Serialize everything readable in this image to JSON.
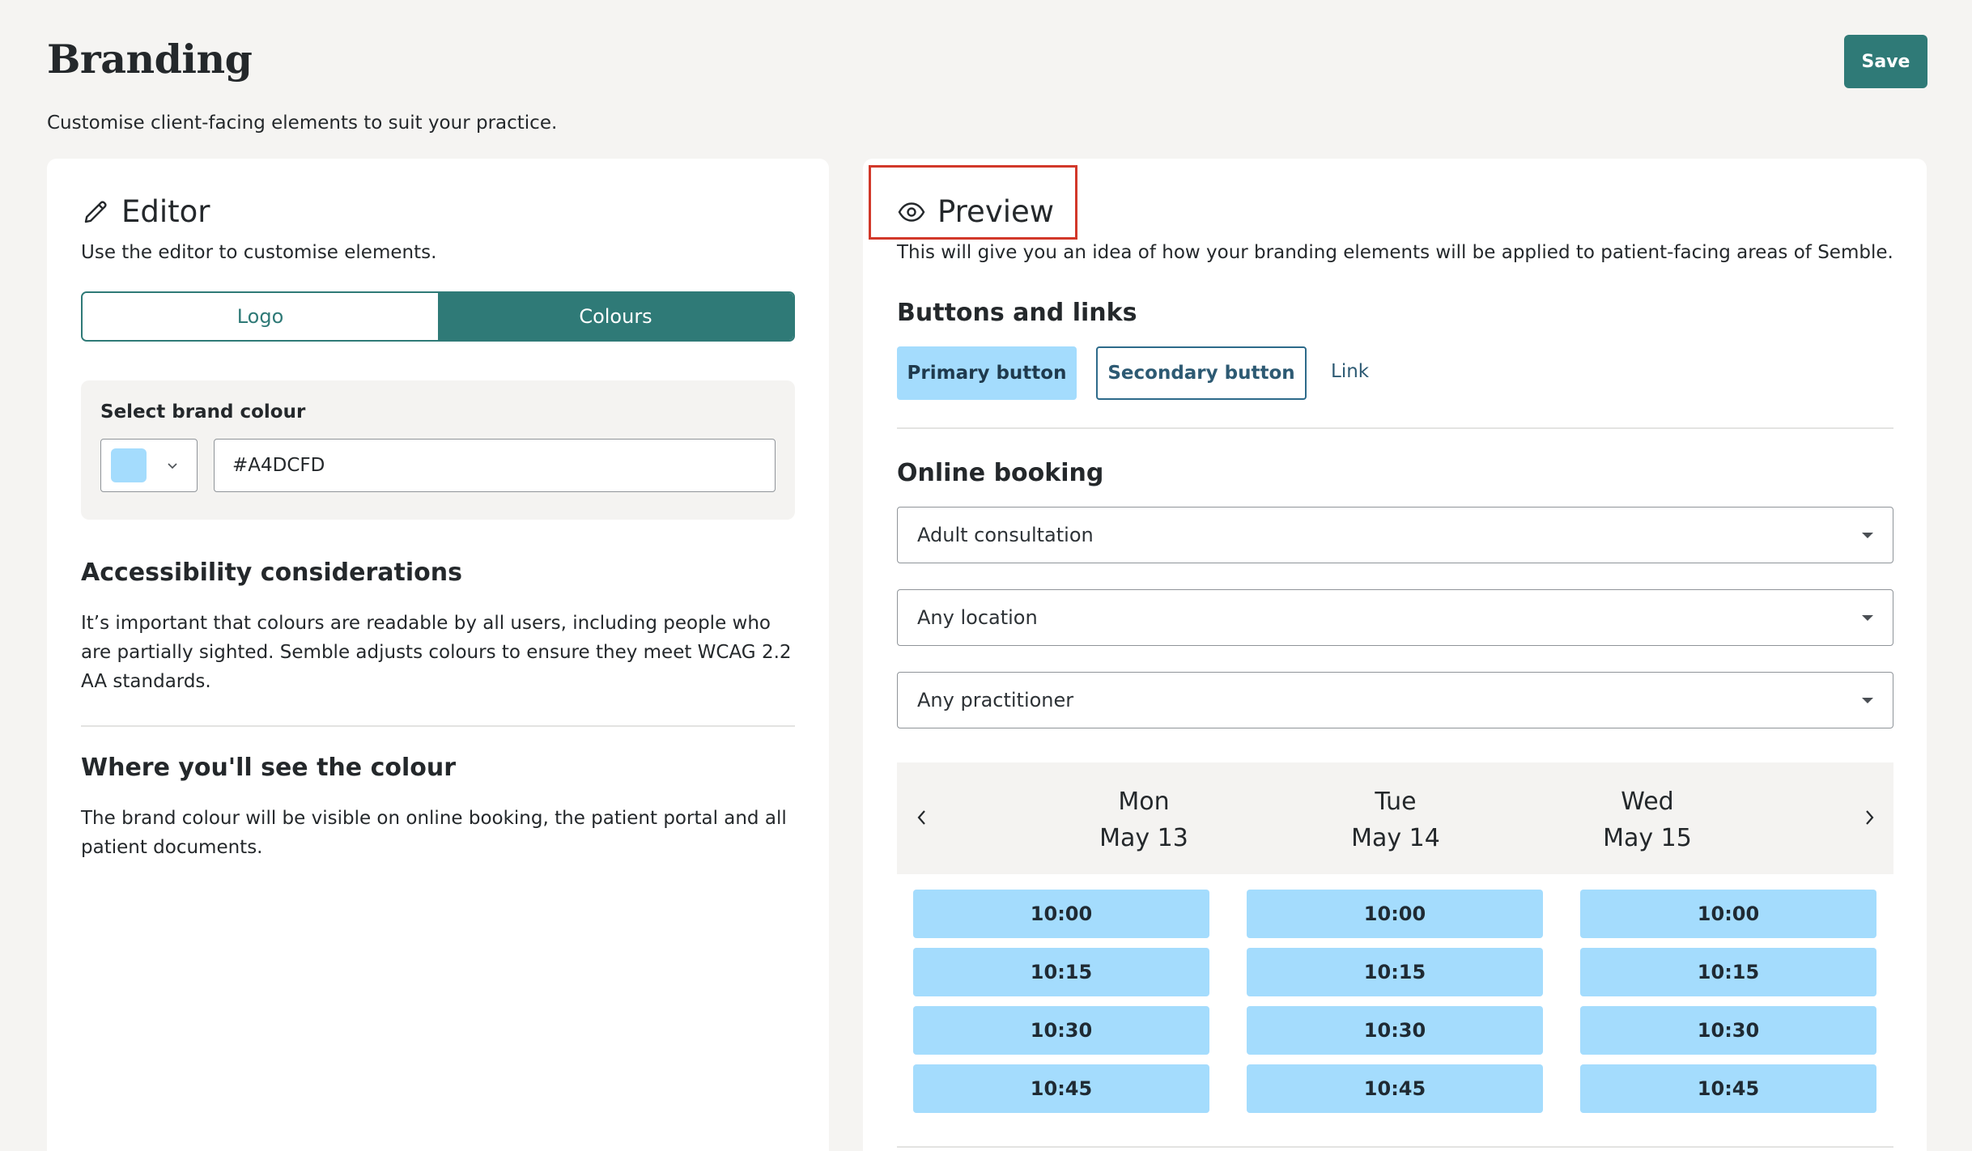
{
  "header": {
    "title": "Branding",
    "subtitle": "Customise client-facing elements to suit your practice.",
    "save_label": "Save"
  },
  "editor": {
    "title": "Editor",
    "description": "Use the editor to customise elements.",
    "tabs": [
      {
        "label": "Logo",
        "active": false
      },
      {
        "label": "Colours",
        "active": true
      }
    ],
    "brand_colour": {
      "label": "Select brand colour",
      "value": "#A4DCFD"
    },
    "accessibility": {
      "title": "Accessibility considerations",
      "body": "It’s important that colours are readable by all users, including people who are partially sighted. Semble adjusts colours to ensure they meet WCAG 2.2 AA standards."
    },
    "where": {
      "title": "Where you'll see the colour",
      "body": "The brand colour will be visible on online booking, the patient portal and all patient documents."
    }
  },
  "preview": {
    "title": "Preview",
    "description": "This will give you an idea of how your branding elements will be applied to patient-facing areas of Semble.",
    "buttons_section": {
      "title": "Buttons and links",
      "primary_label": "Primary button",
      "secondary_label": "Secondary button",
      "link_label": "Link"
    },
    "booking": {
      "title": "Online booking",
      "selects": [
        "Adult consultation",
        "Any location",
        "Any practitioner"
      ],
      "days": [
        {
          "day": "Mon",
          "date": "May 13"
        },
        {
          "day": "Tue",
          "date": "May 14"
        },
        {
          "day": "Wed",
          "date": "May 15"
        }
      ],
      "slots": [
        "10:00",
        "10:15",
        "10:30",
        "10:45"
      ]
    }
  },
  "colors": {
    "brand": "#A4DCFD",
    "accent": "#2F7A77",
    "highlight": "#D2382A"
  },
  "icons": {
    "editor": "pencil-icon",
    "preview": "eye-icon",
    "prev": "chevron-left-icon",
    "next": "chevron-right-icon"
  }
}
